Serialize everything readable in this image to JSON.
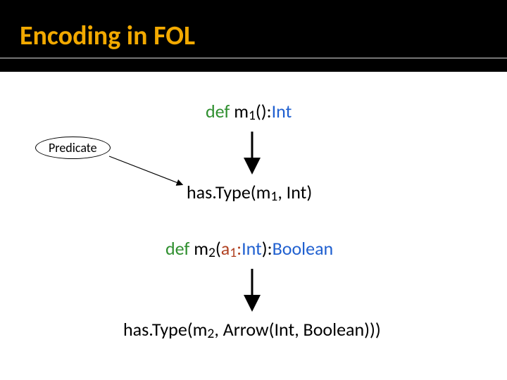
{
  "title": "Encoding in FOL",
  "predicate_label": "Predicate",
  "line1": {
    "def": "def ",
    "name": "m",
    "sub": "1",
    "after_name": "():",
    "rettype": "Int"
  },
  "line2": {
    "fn": "has.Type(m",
    "sub": "1",
    "rest": ", Int)"
  },
  "line3": {
    "def": "def ",
    "name": "m",
    "sub": "2",
    "paren_open": "(",
    "param_a": "a",
    "param_sub": "1",
    "param_colon": ":",
    "param_type": "Int",
    "paren_close": "):",
    "rettype": "Boolean"
  },
  "line4": {
    "fn": "has.Type(m",
    "sub": "2",
    "rest": ", Arrow(Int, Boolean)))"
  }
}
